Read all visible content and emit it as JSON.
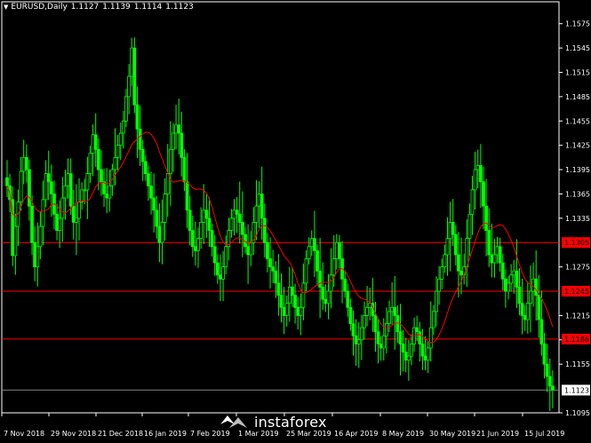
{
  "header": {
    "symbol": "EURUSD,Daily",
    "open": "1.1127",
    "high": "1.1139",
    "low": "1.1114",
    "close": "1.1123"
  },
  "watermark": {
    "text": "instaforex"
  },
  "colors": {
    "background": "#000000",
    "candle": "#00ff00",
    "moving_average": "#ff0000",
    "level_line": "#ff0000",
    "level_label_bg": "#ff0000",
    "current_price_line": "#808080",
    "axis": "#ffffff"
  },
  "chart_data": {
    "type": "candlestick",
    "symbol": "EURUSD",
    "timeframe": "Daily",
    "y_range": [
      1.1095,
      1.159
    ],
    "y_ticks": [
      "1.1575",
      "1.1545",
      "1.1515",
      "1.1485",
      "1.1455",
      "1.1425",
      "1.1395",
      "1.1365",
      "1.1335",
      "1.1305",
      "1.1275",
      "1.1245",
      "1.1215",
      "1.1185",
      "1.1155",
      "1.1123",
      "1.1095"
    ],
    "x_labels": [
      "7 Nov 2018",
      "29 Nov 2018",
      "21 Dec 2018",
      "16 Jan 2019",
      "7 Feb 2019",
      "1 Mar 2019",
      "25 Mar 2019",
      "16 Apr 2019",
      "8 May 2019",
      "30 May 2019",
      "21 Jun 2019",
      "15 Jul 2019"
    ],
    "horizontal_levels": [
      {
        "value": 1.1305,
        "label": "1.1305"
      },
      {
        "value": 1.1245,
        "label": "1.1245"
      },
      {
        "value": 1.1186,
        "label": "1.1186"
      }
    ],
    "current_price": {
      "value": 1.1123,
      "label": "1.1123"
    },
    "close_series": [
      1.1375,
      1.1358,
      1.1289,
      1.1325,
      1.1355,
      1.1393,
      1.141,
      1.1395,
      1.135,
      1.1305,
      1.1275,
      1.13,
      1.1325,
      1.1358,
      1.139,
      1.138,
      1.1365,
      1.134,
      1.132,
      1.1335,
      1.136,
      1.1375,
      1.139,
      1.135,
      1.133,
      1.1335,
      1.1355,
      1.137,
      1.137,
      1.139,
      1.1415,
      1.1438,
      1.142,
      1.1395,
      1.138,
      1.1365,
      1.136,
      1.1375,
      1.1395,
      1.141,
      1.1425,
      1.144,
      1.1455,
      1.1485,
      1.151,
      1.1545,
      1.1475,
      1.1445,
      1.142,
      1.1405,
      1.139,
      1.1375,
      1.136,
      1.1345,
      1.1325,
      1.1305,
      1.133,
      1.1365,
      1.139,
      1.142,
      1.144,
      1.145,
      1.144,
      1.141,
      1.138,
      1.1345,
      1.132,
      1.13,
      1.1295,
      1.131,
      1.133,
      1.1345,
      1.1335,
      1.132,
      1.13,
      1.128,
      1.1265,
      1.126,
      1.1275,
      1.13,
      1.132,
      1.1335,
      1.1345,
      1.134,
      1.133,
      1.1315,
      1.13,
      1.129,
      1.1305,
      1.133,
      1.135,
      1.1365,
      1.1335,
      1.1305,
      1.1285,
      1.1275,
      1.127,
      1.1255,
      1.124,
      1.1225,
      1.1215,
      1.123,
      1.125,
      1.124,
      1.1225,
      1.1215,
      1.1225,
      1.1255,
      1.1285,
      1.13,
      1.131,
      1.1295,
      1.127,
      1.125,
      1.1235,
      1.123,
      1.1245,
      1.1265,
      1.1285,
      1.1305,
      1.1285,
      1.126,
      1.1245,
      1.1225,
      1.1205,
      1.119,
      1.118,
      1.1185,
      1.12,
      1.1215,
      1.1225,
      1.123,
      1.1215,
      1.1195,
      1.118,
      1.1175,
      1.119,
      1.1205,
      1.122,
      1.1225,
      1.1215,
      1.1195,
      1.118,
      1.117,
      1.116,
      1.1165,
      1.118,
      1.12,
      1.1195,
      1.118,
      1.1165,
      1.116,
      1.1175,
      1.12,
      1.122,
      1.1245,
      1.126,
      1.1275,
      1.129,
      1.131,
      1.133,
      1.1315,
      1.129,
      1.127,
      1.1265,
      1.1275,
      1.131,
      1.134,
      1.137,
      1.1395,
      1.14,
      1.138,
      1.135,
      1.132,
      1.129,
      1.128,
      1.129,
      1.13,
      1.128,
      1.126,
      1.1245,
      1.1255,
      1.1265,
      1.127,
      1.125,
      1.123,
      1.1215,
      1.121,
      1.123,
      1.1245,
      1.126,
      1.124,
      1.121,
      1.118,
      1.1155,
      1.114,
      1.1128,
      1.1123
    ]
  }
}
